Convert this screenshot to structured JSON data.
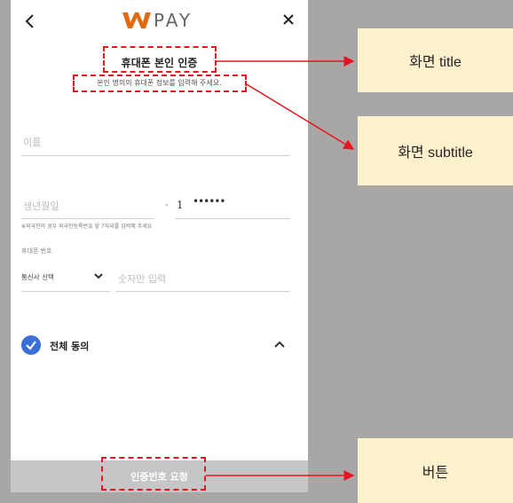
{
  "header": {
    "back_icon": "chevron-left-icon",
    "logo_text": "PAY",
    "close_icon": "close-icon"
  },
  "screen": {
    "title": "휴대폰 본인 인증",
    "subtitle": "본인 명의의 휴대폰 정보를 입력해 주세요."
  },
  "form": {
    "name_placeholder": "이름",
    "birth_placeholder": "생년월일",
    "dash": "-",
    "rrn_first_digit": "1",
    "rrn_mask": "••••••",
    "foreigner_notice": "※외국인의 경우 외국인등록번호 앞 7자리를 입력해 주세요",
    "phone_label": "휴대폰 번호",
    "carrier_value": "통신사 선택",
    "phone_placeholder": "숫자만 입력"
  },
  "agreement": {
    "label": "전체 동의",
    "checked": true
  },
  "footer": {
    "button_label": "인증번호 요청"
  },
  "annotations": {
    "title_callout": "화면 title",
    "subtitle_callout": "화면 subtitle",
    "button_callout": "버튼"
  },
  "colors": {
    "annotation_red": "#e8141f",
    "callout_bg": "#fff1cc",
    "check_blue": "#3a6fd8",
    "button_disabled": "#c6c6c6",
    "background": "#a9a6a6"
  }
}
